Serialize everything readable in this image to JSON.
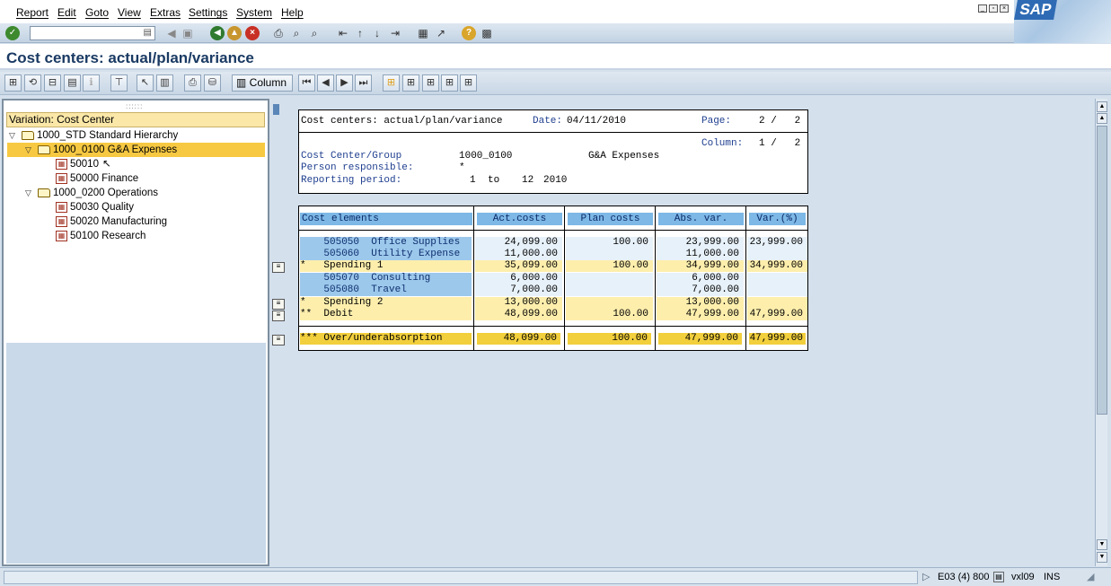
{
  "menu": {
    "items": [
      "Report",
      "Edit",
      "Goto",
      "View",
      "Extras",
      "Settings",
      "System",
      "Help"
    ]
  },
  "logo": {
    "text": "SAP"
  },
  "toolbar": {
    "command_value": "",
    "icons": [
      "enter-icon",
      "back-icon",
      "exit-icon",
      "cancel-icon",
      "print-icon",
      "find-icon",
      "find-next-icon",
      "first-page-icon",
      "prev-page-icon",
      "next-page-icon",
      "last-page-icon",
      "new-session-icon",
      "shortcut-icon",
      "help-icon",
      "layout-icon"
    ]
  },
  "title": "Cost centers: actual/plan/variance",
  "app_toolbar": {
    "column_label": "Column"
  },
  "tree": {
    "header": "Variation: Cost Center",
    "nodes": [
      {
        "label": "1000_STD Standard Hierarchy"
      },
      {
        "label": "1000_0100 G&A Expenses"
      },
      {
        "label": "50010"
      },
      {
        "label": "50000 Finance"
      },
      {
        "label": "1000_0200 Operations"
      },
      {
        "label": "50030 Quality"
      },
      {
        "label": "50020 Manufacturing"
      },
      {
        "label": "50100 Research"
      }
    ]
  },
  "report_header": {
    "title": "Cost centers: actual/plan/variance",
    "date_label": "Date:",
    "date_value": "04/11/2010",
    "page_label": "Page:",
    "page_value": "2 /   2",
    "column_label": "Column:",
    "column_value": "1 /   2",
    "cc_group_label": "Cost Center/Group",
    "cc_group_value": "1000_0100",
    "cc_group_name": "G&A Expenses",
    "person_label": "Person responsible:",
    "person_value": "*",
    "period_label": "Reporting period:",
    "period_from": "1",
    "period_to_word": "to",
    "period_to": "12",
    "period_year": "2010"
  },
  "report_table": {
    "columns": [
      "Cost elements",
      "Act.costs",
      "Plan costs",
      "Abs. var.",
      "Var.(%)"
    ],
    "rows": [
      {
        "label": "    505050  Office Supplies",
        "act": "24,099.00",
        "plan": "100.00",
        "abs": "23,999.00",
        "var": "23,999.00"
      },
      {
        "label": "    505060  Utility Expense",
        "act": "11,000.00",
        "plan": "",
        "abs": "11,000.00",
        "var": ""
      },
      {
        "label": "*   Spending 1",
        "act": "35,099.00",
        "plan": "100.00",
        "abs": "34,999.00",
        "var": "34,999.00"
      },
      {
        "label": "    505070  Consulting",
        "act": "6,000.00",
        "plan": "",
        "abs": "6,000.00",
        "var": ""
      },
      {
        "label": "    505080  Travel",
        "act": "7,000.00",
        "plan": "",
        "abs": "7,000.00",
        "var": ""
      },
      {
        "label": "*   Spending 2",
        "act": "13,000.00",
        "plan": "",
        "abs": "13,000.00",
        "var": ""
      },
      {
        "label": "**  Debit",
        "act": "48,099.00",
        "plan": "100.00",
        "abs": "47,999.00",
        "var": "47,999.00"
      }
    ],
    "total": {
      "label": "*** Over/underabsorption",
      "act": "48,099.00",
      "plan": "100.00",
      "abs": "47,999.00",
      "var": "47,999.00"
    }
  },
  "status": {
    "system": "E03 (4) 800",
    "client": "vxl09",
    "mode": "INS"
  },
  "colors": {
    "header_blue": "#7db8e6",
    "subtotal_yellow": "#fdeeac",
    "total_gold": "#f2cf3c",
    "selected_node": "#f7c942"
  }
}
